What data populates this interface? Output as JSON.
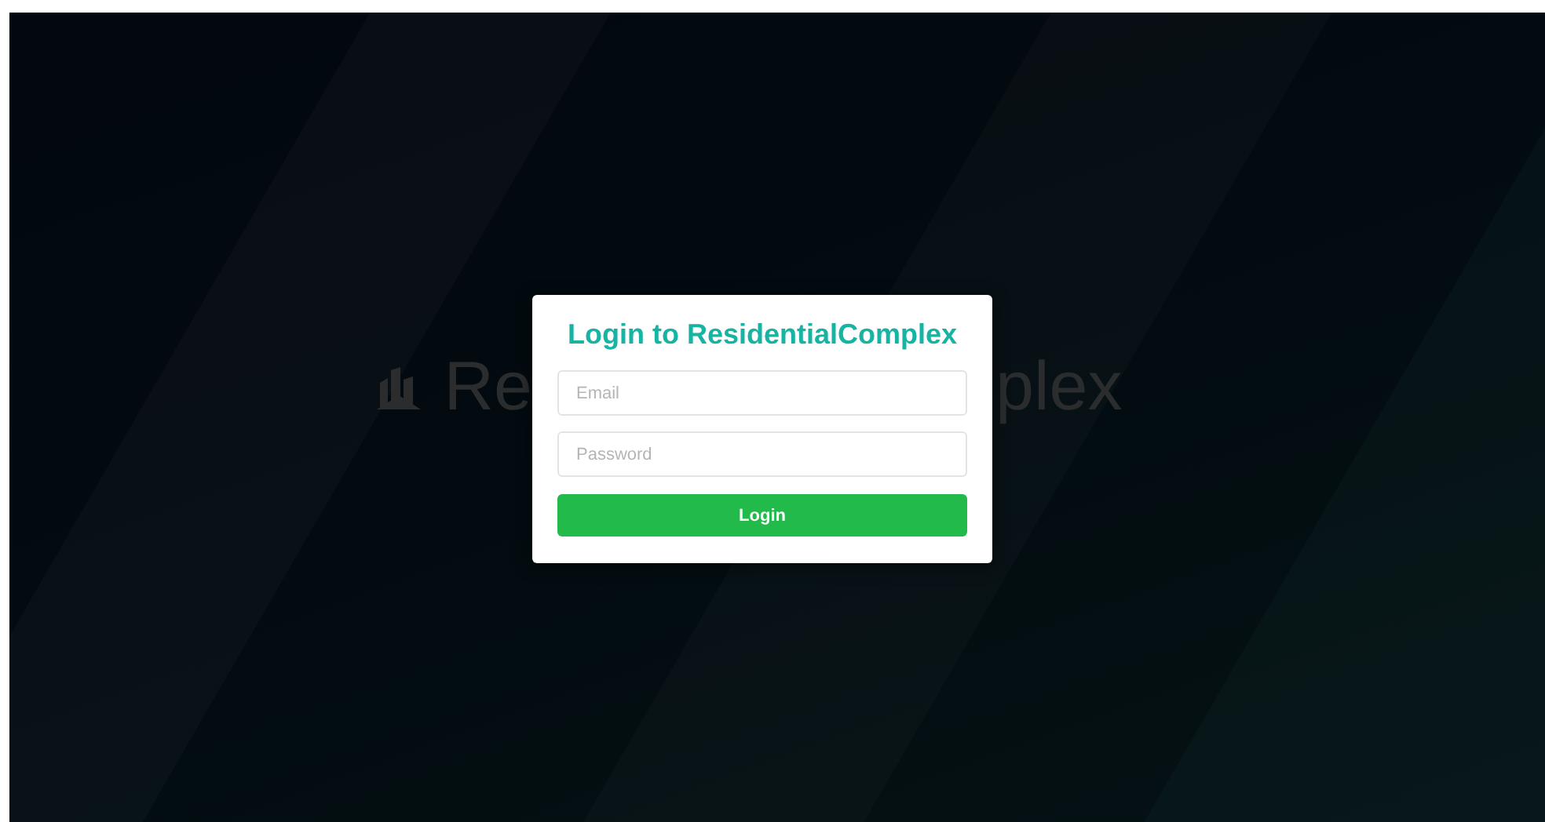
{
  "background_logo": {
    "text_left": "Re",
    "text_right": "plex"
  },
  "login_dialog": {
    "title": "Login to ResidentialComplex",
    "email_field": {
      "placeholder": "Email"
    },
    "password_field": {
      "placeholder": "Password"
    },
    "submit_button": "Login"
  }
}
